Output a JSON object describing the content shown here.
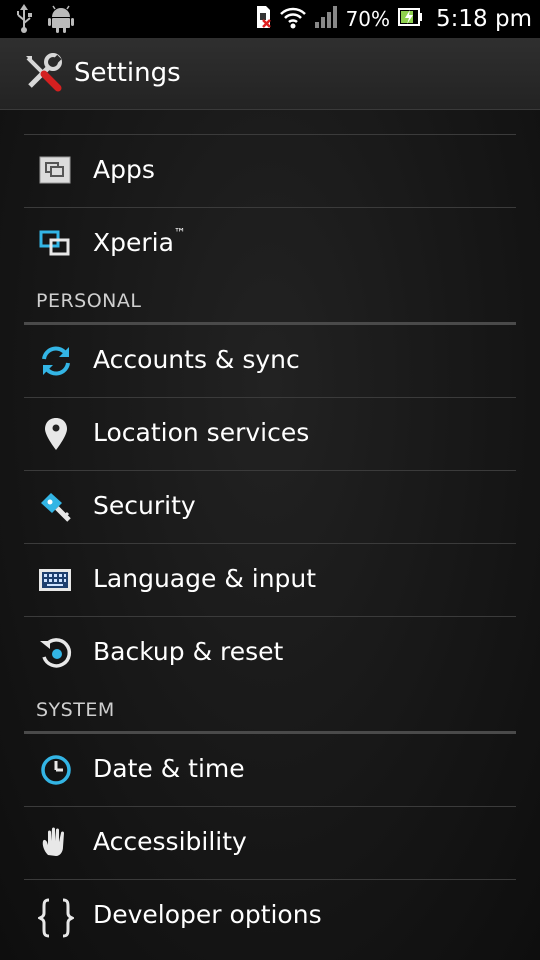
{
  "status_bar": {
    "battery_percent": "70%",
    "time": "5:18 pm",
    "icons": [
      "usb-icon",
      "android-debug-icon",
      "sim-error-icon",
      "wifi-icon",
      "signal-icon",
      "battery-charging-icon"
    ]
  },
  "action_bar": {
    "title": "Settings",
    "icon": "settings-tools-icon"
  },
  "list": {
    "items_top": [
      {
        "label": "Apps",
        "icon": "apps-icon"
      },
      {
        "label": "Xperia",
        "trademark": "™",
        "icon": "xperia-icon"
      }
    ],
    "personal_header": "PERSONAL",
    "personal_items": [
      {
        "label": "Accounts & sync",
        "icon": "sync-icon"
      },
      {
        "label": "Location services",
        "icon": "location-pin-icon"
      },
      {
        "label": "Security",
        "icon": "security-key-icon"
      },
      {
        "label": "Language & input",
        "icon": "keyboard-icon"
      },
      {
        "label": "Backup & reset",
        "icon": "backup-reset-icon"
      }
    ],
    "system_header": "SYSTEM",
    "system_items": [
      {
        "label": "Date & time",
        "icon": "clock-icon"
      },
      {
        "label": "Accessibility",
        "icon": "hand-icon"
      },
      {
        "label": "Developer options",
        "icon": "braces-icon"
      }
    ]
  },
  "colors": {
    "accent_blue": "#33b5e5",
    "background": "#161616",
    "divider": "#3b3b3b"
  }
}
